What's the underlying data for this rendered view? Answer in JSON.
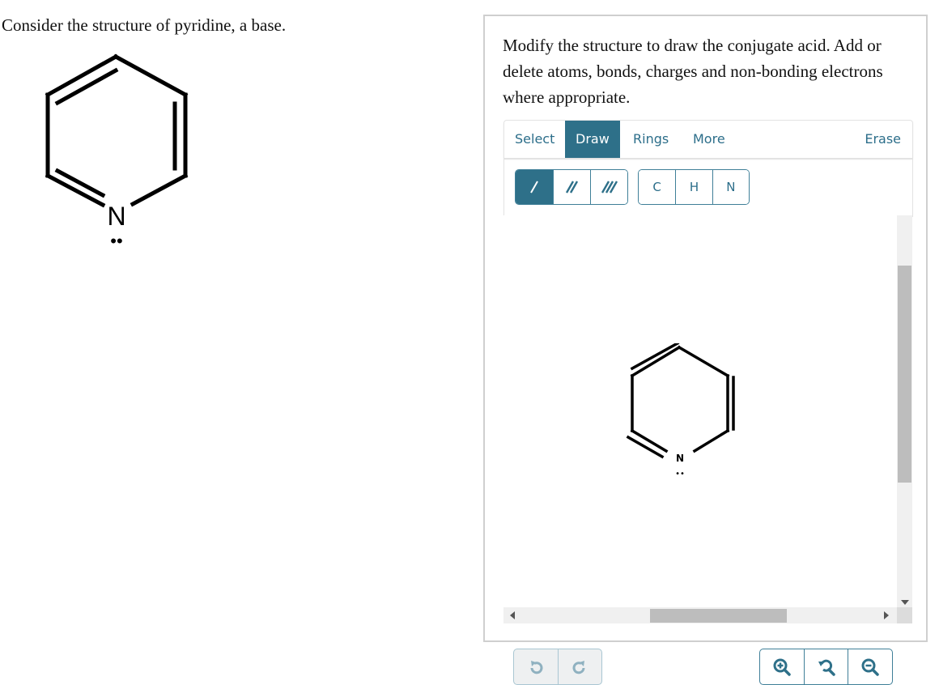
{
  "question": {
    "text": "Consider the structure of pyridine, a base.",
    "molecule": {
      "name": "pyridine",
      "heteroatom": "N",
      "lone_pair": "••"
    }
  },
  "panel": {
    "instructions": "Modify the structure to draw the conjugate acid. Add or delete atoms, bonds, charges and non-bonding electrons where appropriate.",
    "tabs": [
      {
        "label": "Select",
        "active": false
      },
      {
        "label": "Draw",
        "active": true
      },
      {
        "label": "Rings",
        "active": false
      },
      {
        "label": "More",
        "active": false
      },
      {
        "label": "Erase",
        "active": false
      }
    ],
    "bond_tools": [
      {
        "name": "single-bond",
        "icon": "single-bond-icon",
        "active": true
      },
      {
        "name": "double-bond",
        "icon": "double-bond-icon",
        "active": false
      },
      {
        "name": "triple-bond",
        "icon": "triple-bond-icon",
        "active": false
      }
    ],
    "atom_tools": [
      {
        "label": "C"
      },
      {
        "label": "H"
      },
      {
        "label": "N"
      }
    ],
    "canvas": {
      "molecule": {
        "name": "pyridine",
        "atom_label": "N",
        "lone_pair": "••"
      }
    },
    "history_buttons": [
      {
        "name": "undo",
        "icon": "undo-icon"
      },
      {
        "name": "redo",
        "icon": "redo-icon"
      }
    ],
    "zoom_buttons": [
      {
        "name": "zoom-in",
        "icon": "zoom-in-icon"
      },
      {
        "name": "reset-zoom",
        "icon": "reset-zoom-icon"
      },
      {
        "name": "zoom-out",
        "icon": "zoom-out-icon"
      }
    ],
    "scroll": {
      "vertical_position_fraction": 0.22,
      "vertical_visible_fraction": 0.57,
      "horizontal_position_fraction": 0.36,
      "horizontal_visible_fraction": 0.38
    },
    "colors": {
      "accent": "#2e7089",
      "border": "#3f7f98",
      "disabled_border": "#a9c6d2"
    }
  }
}
